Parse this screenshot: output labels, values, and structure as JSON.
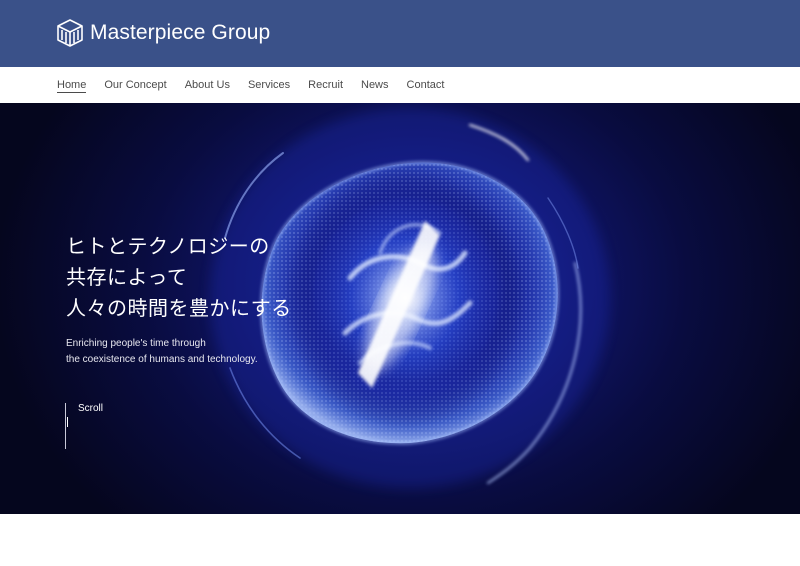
{
  "header": {
    "brand": "Masterpiece Group",
    "logo_icon": "cube-logo-icon",
    "background_color": "#3a5189"
  },
  "nav": {
    "items": [
      {
        "label": "Home",
        "active": true
      },
      {
        "label": "Our Concept",
        "active": false
      },
      {
        "label": "About Us",
        "active": false
      },
      {
        "label": "Services",
        "active": false
      },
      {
        "label": "Recruit",
        "active": false
      },
      {
        "label": "News",
        "active": false
      },
      {
        "label": "Contact",
        "active": false
      }
    ]
  },
  "hero": {
    "headline": [
      "ヒトとテクノロジーの",
      "共存によって",
      "人々の時間を豊かにする"
    ],
    "subline": [
      "Enriching people's time through",
      "the coexistence of humans and technology."
    ],
    "scroll_label": "Scroll",
    "background_color": "#090c40",
    "glow_color": "#3a6bff"
  }
}
